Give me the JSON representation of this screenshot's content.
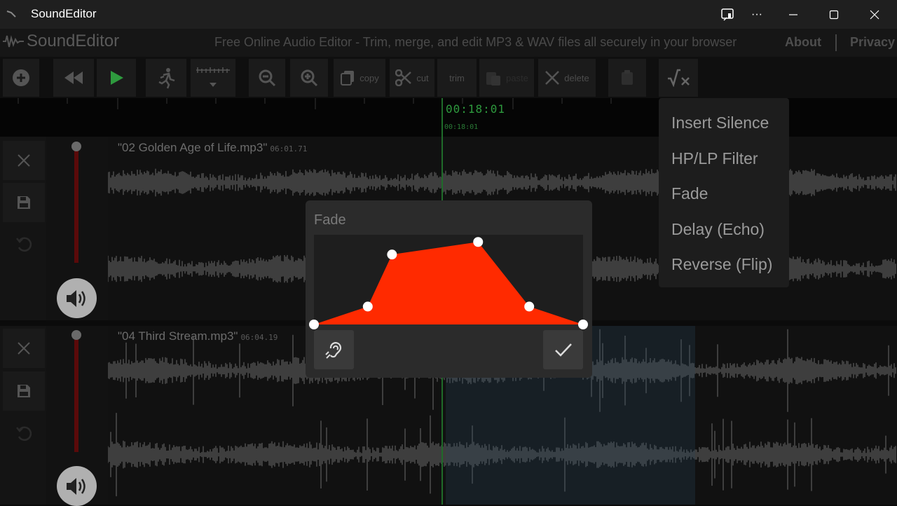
{
  "window": {
    "title": "SoundEditor",
    "more_label": "···"
  },
  "header": {
    "brand": "SoundEditor",
    "tagline": "Free Online Audio Editor - Trim, merge, and edit MP3 & WAV files all securely in your browser",
    "about_label": "About",
    "privacy_label": "Privacy"
  },
  "toolbar": {
    "copy_label": "copy",
    "cut_label": "cut",
    "trim_label": "trim",
    "paste_label": "paste",
    "delete_label": "delete"
  },
  "timeline": {
    "current_time": "00:18:01",
    "current_time_small": "00:18:01"
  },
  "tracks": [
    {
      "name": "\"02 Golden Age of Life.mp3\"",
      "duration": "06:01.71"
    },
    {
      "name": "\"04 Third Stream.mp3\"",
      "duration": "06:04.19"
    }
  ],
  "fx_menu": {
    "items": [
      "Insert Silence",
      "HP/LP Filter",
      "Fade",
      "Delay (Echo)",
      "Reverse (Flip)"
    ]
  },
  "fade_dialog": {
    "title": "Fade",
    "envelope_levels": [
      0.0,
      0.2,
      0.78,
      0.92,
      0.2,
      0.0
    ],
    "envelope_positions": [
      0.0,
      0.2,
      0.29,
      0.61,
      0.8,
      1.0
    ],
    "fill_color": "#ff2a00"
  },
  "colors": {
    "accent_green": "#2e9a3e",
    "envelope_red": "#ff2a00"
  }
}
